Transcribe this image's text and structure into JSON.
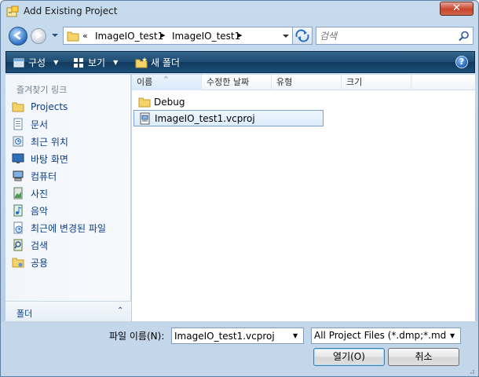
{
  "window": {
    "title": "Add Existing Project",
    "close_label": "✕"
  },
  "nav": {
    "breadcrumb_prefix": "«",
    "breadcrumbs": [
      "ImageIO_test1",
      "ImageIO_test1"
    ],
    "crumb_sep": "▸",
    "search_placeholder": "검색"
  },
  "toolbar": {
    "organize": "구성",
    "views": "보기",
    "new_folder": "새 폴더",
    "help": "?"
  },
  "sidebar": {
    "heading": "즐겨찾기 링크",
    "items": [
      {
        "label": "Projects",
        "icon": "folder-icon"
      },
      {
        "label": "문서",
        "icon": "documents-icon"
      },
      {
        "label": "최근 위치",
        "icon": "recent-places-icon"
      },
      {
        "label": "바탕 화면",
        "icon": "desktop-icon"
      },
      {
        "label": "컴퓨터",
        "icon": "computer-icon"
      },
      {
        "label": "사진",
        "icon": "pictures-icon"
      },
      {
        "label": "음악",
        "icon": "music-icon"
      },
      {
        "label": "최근에 변경된 파일",
        "icon": "recently-changed-icon"
      },
      {
        "label": "검색",
        "icon": "search-folder-icon"
      },
      {
        "label": "공용",
        "icon": "public-folder-icon"
      }
    ],
    "folder_label": "폴더",
    "folder_toggle": "⌃"
  },
  "columns": {
    "name": "이름",
    "date": "수정한 날짜",
    "type": "유형",
    "size": "크기",
    "sort_indicator": "^"
  },
  "files": [
    {
      "name": "Debug",
      "icon": "folder-icon",
      "selected": false
    },
    {
      "name": "ImageIO_test1.vcproj",
      "icon": "vcproj-file-icon",
      "selected": true
    }
  ],
  "footer": {
    "filename_label": "파일 이름(N):",
    "filename_value": "ImageIO_test1.vcproj",
    "filter_value": "All Project Files (*.dmp;*.md",
    "open_label": "열기(O)",
    "cancel_label": "취소"
  },
  "colors": {
    "toolbar_bg": "#1d4a70",
    "link_text": "#0a3d8a",
    "selection_border": "#7da2ce",
    "close_red": "#c8452b"
  }
}
